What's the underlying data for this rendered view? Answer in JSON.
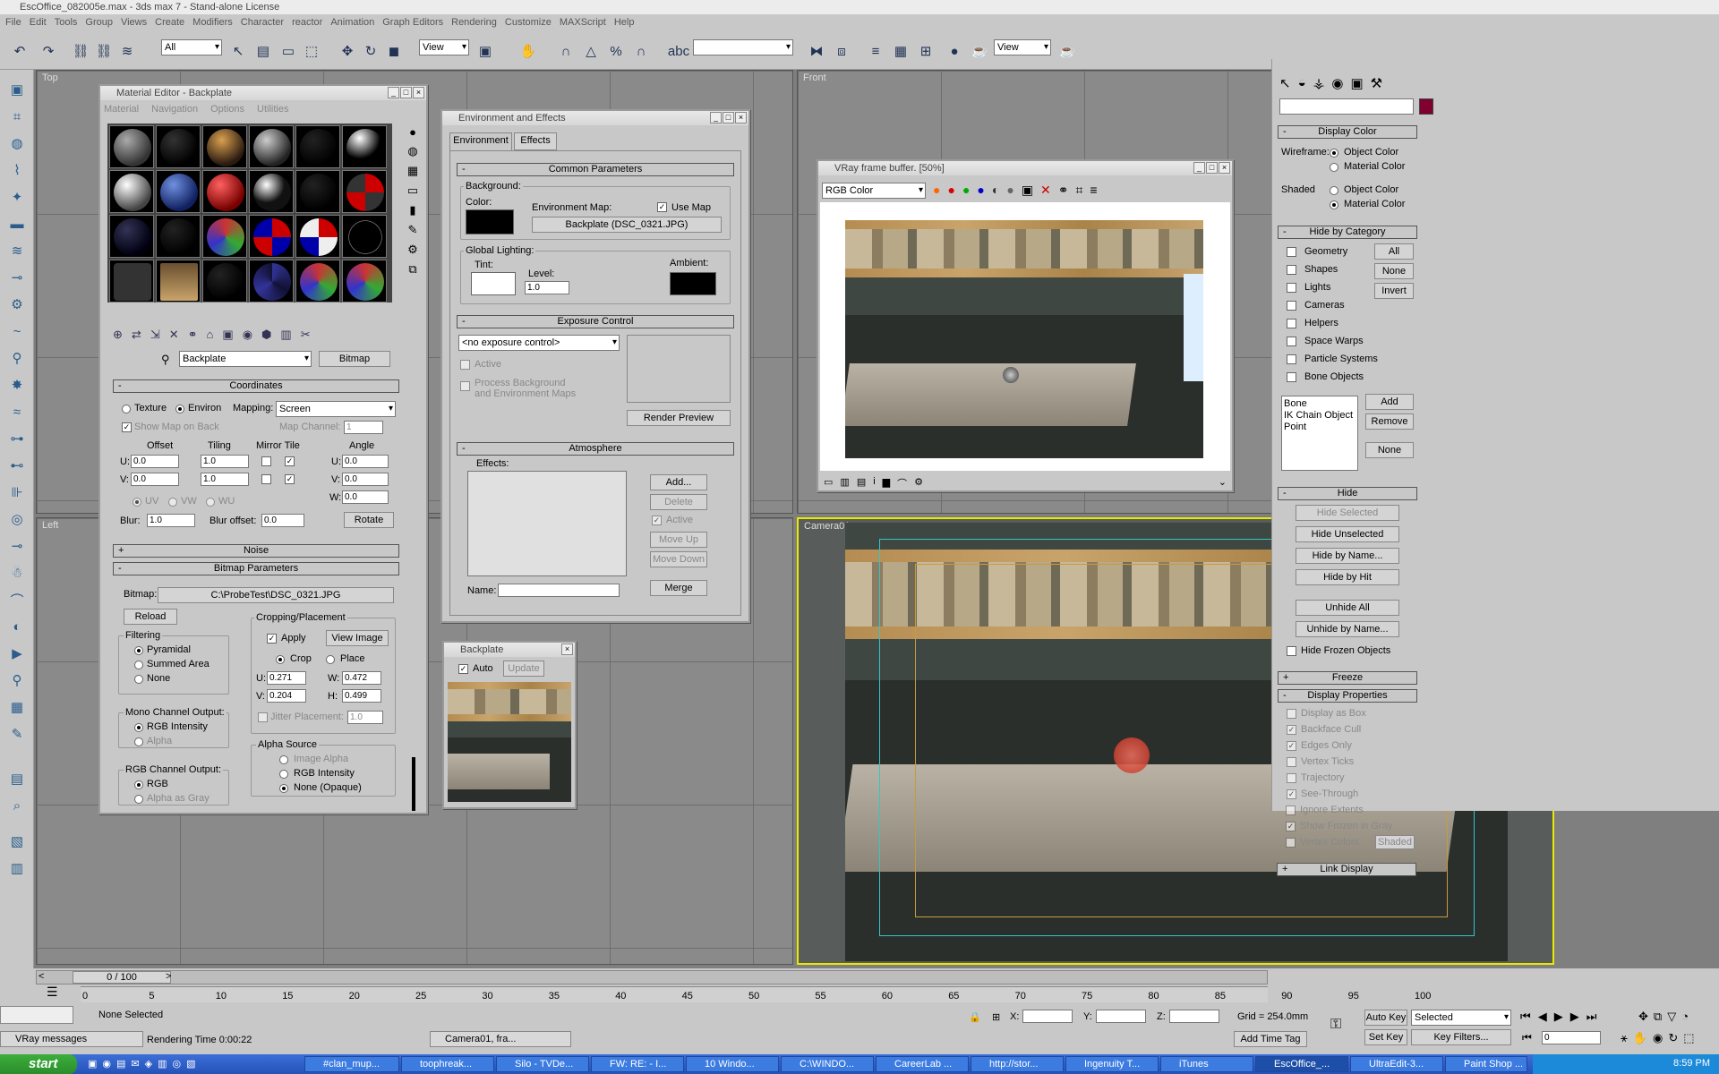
{
  "window": {
    "title": "EscOffice_082005e.max - 3ds max 7 - Stand-alone License"
  },
  "menu": [
    "File",
    "Edit",
    "Tools",
    "Group",
    "Views",
    "Create",
    "Modifiers",
    "Character",
    "reactor",
    "Animation",
    "Graph Editors",
    "Rendering",
    "Customize",
    "MAXScript",
    "Help"
  ],
  "toolbar": {
    "selection_filter": "All",
    "ref_coord": "View",
    "render_view": "View"
  },
  "viewports": {
    "top": "Top",
    "front": "Front",
    "left": "Left",
    "camera": "Camera01"
  },
  "material_editor": {
    "title": "Material Editor - Backplate",
    "menu": [
      "Material",
      "Navigation",
      "Options",
      "Utilities"
    ],
    "map_name": "Backplate",
    "map_type": "Bitmap",
    "coordinates": {
      "header": "Coordinates",
      "texture": "Texture",
      "environ": "Environ",
      "mapping_label": "Mapping:",
      "mapping": "Screen",
      "show_map": "Show Map on Back",
      "map_channel_label": "Map Channel:",
      "map_channel": "1",
      "offset": "Offset",
      "tiling": "Tiling",
      "mirror_tile": "Mirror Tile",
      "angle": "Angle",
      "mirror": "Mirror",
      "tile": "Tile",
      "u": "U:",
      "v": "V:",
      "w": "W:",
      "u_offset": "0.0",
      "v_offset": "0.0",
      "u_tiling": "1.0",
      "v_tiling": "1.0",
      "u_angle": "0.0",
      "v_angle": "0.0",
      "w_angle": "0.0",
      "uv": "UV",
      "vw": "VW",
      "wu": "WU",
      "blur_label": "Blur:",
      "blur": "1.0",
      "blur_offset_label": "Blur offset:",
      "blur_offset": "0.0",
      "rotate": "Rotate"
    },
    "noise_header": "Noise",
    "bitmap_params": {
      "header": "Bitmap Parameters",
      "bitmap_label": "Bitmap:",
      "path": "C:\\ProbeTest\\DSC_0321.JPG",
      "reload": "Reload",
      "cropping": "Cropping/Placement",
      "apply": "Apply",
      "view_image": "View Image",
      "crop": "Crop",
      "place": "Place",
      "u": "0.271",
      "v": "0.204",
      "w": "0.472",
      "h": "0.499",
      "u_label": "U:",
      "v_label": "V:",
      "w_label": "W:",
      "h_label": "H:",
      "jitter": "Jitter Placement:",
      "jitter_val": "1.0",
      "filtering": "Filtering",
      "pyramidal": "Pyramidal",
      "summed": "Summed Area",
      "none": "None",
      "mono": "Mono Channel Output:",
      "rgb_intensity": "RGB Intensity",
      "alpha": "Alpha",
      "alpha_source": "Alpha Source",
      "image_alpha": "Image Alpha",
      "rgb_intensity2": "RGB Intensity",
      "none_opaque": "None (Opaque)",
      "rgb_channel": "RGB Channel Output:",
      "rgb": "RGB",
      "alpha_gray": "Alpha as Gray"
    }
  },
  "env": {
    "title": "Environment and Effects",
    "tab_env": "Environment",
    "tab_effects": "Effects",
    "common": "Common Parameters",
    "background": "Background:",
    "color": "Color:",
    "env_map": "Environment Map:",
    "use_map": "Use Map",
    "map_button": "Backplate (DSC_0321.JPG)",
    "global_lighting": "Global Lighting:",
    "tint": "Tint:",
    "level": "Level:",
    "level_val": "1.0",
    "ambient": "Ambient:",
    "exposure": "Exposure Control",
    "exposure_type": "<no exposure control>",
    "active": "Active",
    "process_bg": "Process Background",
    "and_env": "and Environment Maps",
    "render_preview": "Render Preview",
    "atmosphere": "Atmosphere",
    "effects": "Effects:",
    "add": "Add...",
    "delete": "Delete",
    "active2": "Active",
    "move_up": "Move Up",
    "move_down": "Move Down",
    "name": "Name:",
    "merge": "Merge"
  },
  "vray": {
    "title": "VRay frame buffer. [50%]",
    "channel": "RGB Color"
  },
  "backplate_win": {
    "title": "Backplate",
    "auto": "Auto",
    "update": "Update"
  },
  "cmdpanel": {
    "display_color": "Display Color",
    "wireframe": "Wireframe:",
    "shaded": "Shaded",
    "object_color": "Object Color",
    "material_color": "Material Color",
    "hide_by_category": "Hide by Category",
    "categories": [
      "Geometry",
      "Shapes",
      "Lights",
      "Cameras",
      "Helpers",
      "Space Warps",
      "Particle Systems",
      "Bone Objects"
    ],
    "all": "All",
    "none": "None",
    "invert": "Invert",
    "list": [
      "Bone",
      "IK Chain Object",
      "Point"
    ],
    "add": "Add",
    "remove": "Remove",
    "none2": "None",
    "hide": "Hide",
    "hide_selected": "Hide Selected",
    "hide_unselected": "Hide Unselected",
    "hide_by_name": "Hide by Name...",
    "hide_by_hit": "Hide by Hit",
    "unhide_all": "Unhide All",
    "unhide_by_name": "Unhide by Name...",
    "hide_frozen": "Hide Frozen Objects",
    "freeze": "Freeze",
    "display_props": "Display Properties",
    "props": [
      "Display as Box",
      "Backface Cull",
      "Edges Only",
      "Vertex Ticks",
      "Trajectory",
      "See-Through",
      "Ignore Extents",
      "Show Frozen in Gray",
      "Vertex Colors"
    ],
    "link_display": "Link Display"
  },
  "timeline": {
    "frame": "0 / 100",
    "ticks": [
      "0",
      "5",
      "10",
      "15",
      "20",
      "25",
      "30",
      "35",
      "40",
      "45",
      "50",
      "55",
      "60",
      "65",
      "70",
      "75",
      "80",
      "85",
      "90",
      "95",
      "100"
    ]
  },
  "status": {
    "selected": "None Selected",
    "render_time": "Rendering Time 0:00:22",
    "x": "X:",
    "y": "Y:",
    "z": "Z:",
    "grid": "Grid = 254.0mm",
    "add_time_tag": "Add Time Tag",
    "auto_key": "Auto Key",
    "set_key": "Set Key",
    "key_mode": "Selected",
    "key_filters": "Key Filters...",
    "frame": "0",
    "vray_messages": "VRay messages",
    "camera_frame": "Camera01, fra..."
  },
  "taskbar": {
    "start": "start",
    "clock": "8:59 PM",
    "tasks": [
      "#clan_mup...",
      "toophreak...",
      "Silo - TVDe...",
      "FW: RE: - I...",
      "10 Windo...",
      "C:\\WINDO...",
      "CareerLab ...",
      "http://stor...",
      "Ingenuity T...",
      "iTunes",
      "EscOffice_...",
      "UltraEdit-3...",
      "Paint Shop ..."
    ]
  }
}
